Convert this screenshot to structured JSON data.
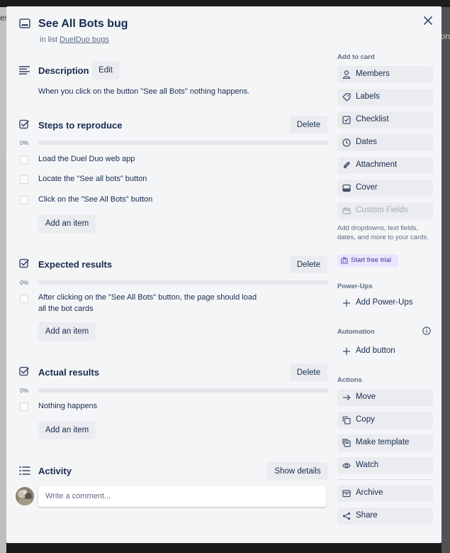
{
  "card": {
    "title": "See All Bots bug",
    "list_prefix": "in list",
    "list_name": "DuelDuo bugs"
  },
  "backdrop": {
    "left_text": "es",
    "right_text": "on"
  },
  "description": {
    "title": "Description",
    "edit_label": "Edit",
    "text": "When you click on the button \"See all Bots\" nothing happens."
  },
  "checklists": [
    {
      "title": "Steps to reproduce",
      "delete_label": "Delete",
      "percent_label": "0%",
      "progress": 0,
      "items": [
        "Load the Duel Duo web app",
        "Locate the \"See all bots\" button",
        "Click on the \"See All Bots\" button"
      ],
      "add_label": "Add an item"
    },
    {
      "title": "Expected results",
      "delete_label": "Delete",
      "percent_label": "0%",
      "progress": 0,
      "items": [
        "After clicking on the \"See All Bots\" button, the page should load",
        "all the bot cards"
      ],
      "add_label": "Add an item"
    },
    {
      "title": "Actual results",
      "delete_label": "Delete",
      "percent_label": "0%",
      "progress": 0,
      "items": [
        "Nothing happens"
      ],
      "add_label": "Add an item"
    }
  ],
  "activity": {
    "title": "Activity",
    "show_details_label": "Show details",
    "comment_placeholder": "Write a comment..."
  },
  "sidebar": {
    "add_to_card_heading": "Add to card",
    "add_to_card": [
      {
        "label": "Members",
        "icon": "person-icon"
      },
      {
        "label": "Labels",
        "icon": "tag-icon"
      },
      {
        "label": "Checklist",
        "icon": "checkbox-icon"
      },
      {
        "label": "Dates",
        "icon": "clock-icon"
      },
      {
        "label": "Attachment",
        "icon": "paperclip-icon"
      },
      {
        "label": "Cover",
        "icon": "cover-icon"
      },
      {
        "label": "Custom Fields",
        "icon": "custom-fields-icon"
      }
    ],
    "custom_fields_help": "Add dropdowns, text fields, dates, and more to your cards.",
    "trial_label": "Start free trial",
    "powerups_heading": "Power-Ups",
    "add_powerups_label": "Add Power-Ups",
    "automation_heading": "Automation",
    "add_button_label": "Add button",
    "actions_heading": "Actions",
    "actions": [
      {
        "label": "Move",
        "icon": "arrow-right-icon"
      },
      {
        "label": "Copy",
        "icon": "copy-icon"
      },
      {
        "label": "Make template",
        "icon": "template-icon"
      },
      {
        "label": "Watch",
        "icon": "eye-icon"
      },
      {
        "label": "Archive",
        "icon": "archive-icon"
      },
      {
        "label": "Share",
        "icon": "share-icon"
      }
    ]
  },
  "colors": {
    "modal_bg": "#f4f5f7",
    "button_bg": "#ebecf0",
    "text": "#172b4d",
    "muted": "#5e6c84",
    "trial_bg": "#eae6ff",
    "trial_text": "#403294"
  }
}
